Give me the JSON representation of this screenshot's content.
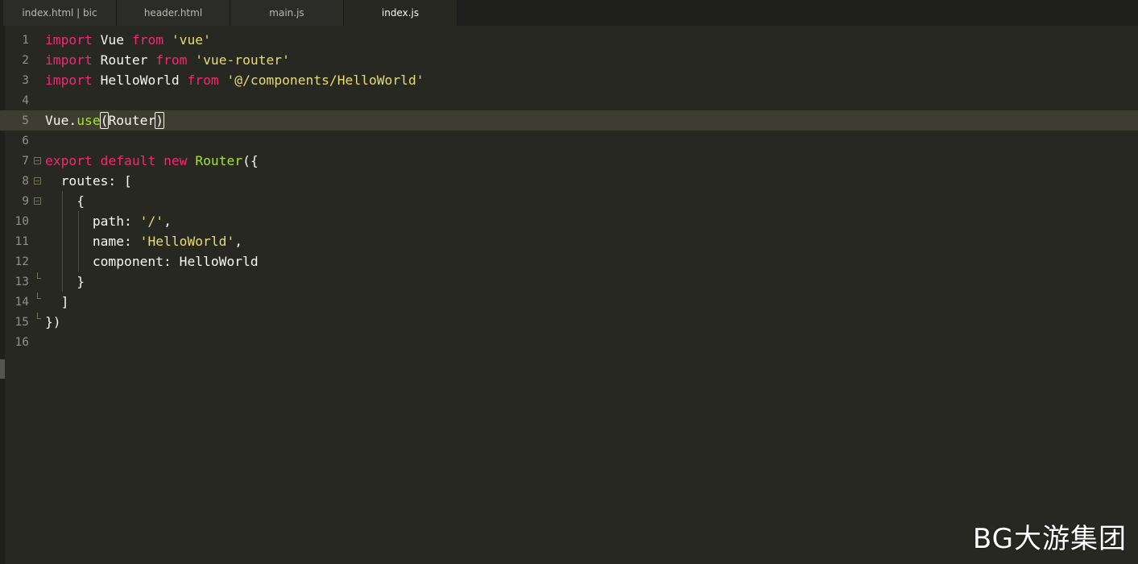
{
  "tabs": [
    {
      "label": "index.html | bic",
      "active": false
    },
    {
      "label": "header.html",
      "active": false
    },
    {
      "label": "main.js",
      "active": false
    },
    {
      "label": "index.js",
      "active": true
    }
  ],
  "editor": {
    "line_numbers": [
      "1",
      "2",
      "3",
      "4",
      "5",
      "6",
      "7",
      "8",
      "9",
      "10",
      "11",
      "12",
      "13",
      "14",
      "15",
      "16"
    ],
    "current_line": 5,
    "colors": {
      "background": "#272822",
      "keyword": "#f92672",
      "string": "#e6db74",
      "function": "#a6e22e",
      "text": "#f8f8f2",
      "gutter": "#8f908a"
    },
    "code": {
      "l1": {
        "kw1": "import",
        "t1": " Vue ",
        "kw2": "from",
        "t2": " ",
        "s1": "'vue'"
      },
      "l2": {
        "kw1": "import",
        "t1": " Router ",
        "kw2": "from",
        "t2": " ",
        "s1": "'vue-router'"
      },
      "l3": {
        "kw1": "import",
        "t1": " HelloWorld ",
        "kw2": "from",
        "t2": " ",
        "s1": "'@/components/HelloWorld'"
      },
      "l5": {
        "t1": "Vue.",
        "fn1": "use",
        "p1": "(",
        "t2": "Router",
        "p2": ")"
      },
      "l7": {
        "kw1": "export",
        "t1": " ",
        "kw2": "default",
        "t2": " ",
        "kw3": "new",
        "t3": " ",
        "fn1": "Router",
        "t4": "({"
      },
      "l8": {
        "t1": "  routes: ["
      },
      "l9": {
        "t1": "    {"
      },
      "l10": {
        "t1": "      path: ",
        "s1": "'/'",
        "t2": ","
      },
      "l11": {
        "t1": "      name: ",
        "s1": "'HelloWorld'",
        "t2": ","
      },
      "l12": {
        "t1": "      component: HelloWorld"
      },
      "l13": {
        "t1": "    }"
      },
      "l14": {
        "t1": "  ]"
      },
      "l15": {
        "t1": "})"
      }
    }
  },
  "watermark": "BG大游集团"
}
